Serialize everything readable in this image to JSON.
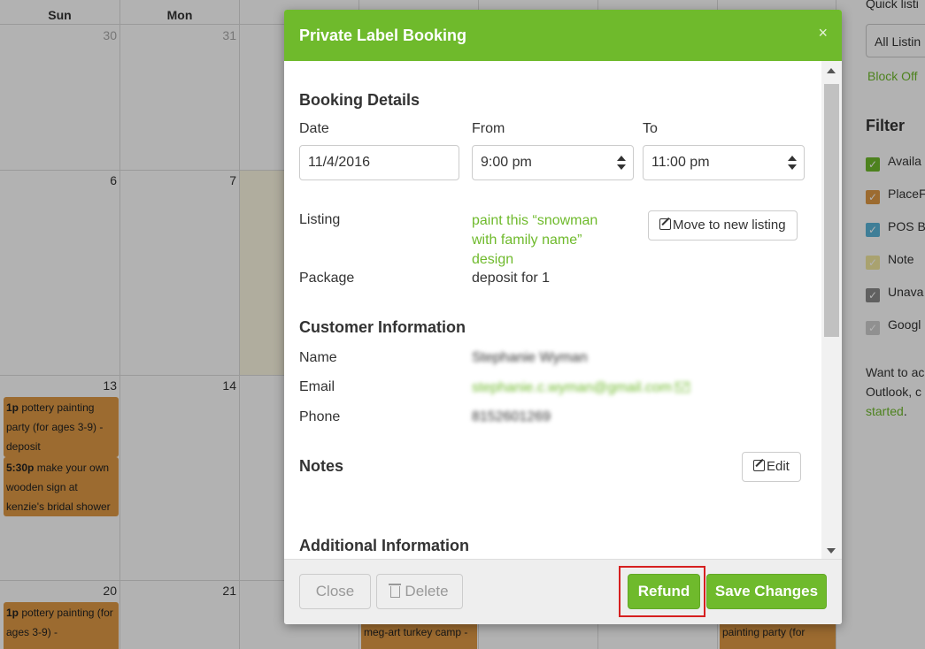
{
  "calendar": {
    "days": [
      "Sun",
      "Mon"
    ],
    "week1": [
      "30",
      "31"
    ],
    "week2": [
      "6",
      "7"
    ],
    "week3": [
      "13",
      "14"
    ],
    "week4": [
      "20",
      "21"
    ],
    "events": {
      "e1_time": "1p",
      "e1_text": "pottery painting party (for ages 3-9) - deposit",
      "e2_time": "5:30p",
      "e2_text": "make your own wooden sign at kenzie's bridal shower",
      "e3_time": "1p",
      "e3_text": "pottery painting (for ages 3-9) -",
      "e4_text": "meg-art turkey camp -",
      "e5_text": "painting party (for"
    }
  },
  "sidepanel": {
    "quick_label": "Quick listi",
    "select_value": "All Listin",
    "block_off": "Block Off",
    "filter_heading": "Filter",
    "filters": [
      {
        "label": "Availa",
        "color": "#6fba2c"
      },
      {
        "label": "PlaceF",
        "color": "#e09a45"
      },
      {
        "label": "POS B",
        "color": "#5bb5d8"
      },
      {
        "label": "Note",
        "color": "#f2e8a0"
      },
      {
        "label": "Unava",
        "color": "#8a8a8a"
      },
      {
        "label": "Googl",
        "color": "#cfcfcf"
      }
    ],
    "note_text": "Want to ac Outlook, c",
    "note_link": "started",
    "note_end": "."
  },
  "modal": {
    "title": "Private Label Booking",
    "close": "×",
    "booking_heading": "Booking Details",
    "date_label": "Date",
    "from_label": "From",
    "to_label": "To",
    "date_value": "11/4/2016",
    "from_value": "9:00 pm",
    "to_value": "11:00 pm",
    "listing_label": "Listing",
    "listing_value": "paint this “snowman with family name” design",
    "move_button": "Move to new listing",
    "package_label": "Package",
    "package_value": "deposit for 1",
    "customer_heading": "Customer Information",
    "name_label": "Name",
    "name_value": "Stephanie Wyman",
    "email_label": "Email",
    "email_value": "stephanie.c.wyman@gmail.com",
    "phone_label": "Phone",
    "phone_value": "8152601269",
    "notes_heading": "Notes",
    "edit_button": "Edit",
    "additional_heading": "Additional Information",
    "footer": {
      "close": "Close",
      "delete": "Delete",
      "refund": "Refund",
      "save": "Save Changes"
    }
  },
  "colors": {
    "accent": "#6fba2c",
    "event": "#e09a45",
    "highlight": "#d62020"
  }
}
